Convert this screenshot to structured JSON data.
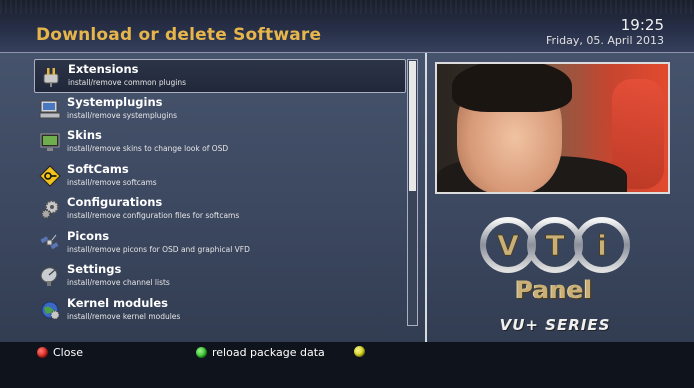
{
  "header": {
    "title": "Download or delete Software",
    "time": "19:25",
    "date": "Friday, 05. April 2013"
  },
  "menu": {
    "items": [
      {
        "title": "Extensions",
        "desc": "install/remove common plugins",
        "icon": "plug-icon",
        "selected": true
      },
      {
        "title": "Systemplugins",
        "desc": "install/remove systemplugins",
        "icon": "computer-icon",
        "selected": false
      },
      {
        "title": "Skins",
        "desc": "install/remove skins to change look of OSD",
        "icon": "monitor-icon",
        "selected": false
      },
      {
        "title": "SoftCams",
        "desc": "install/remove softcams",
        "icon": "key-warning-icon",
        "selected": false
      },
      {
        "title": "Configurations",
        "desc": "install/remove configuration files for softcams",
        "icon": "gears-icon",
        "selected": false
      },
      {
        "title": "Picons",
        "desc": "install/remove picons for OSD and graphical VFD",
        "icon": "satellite-icon",
        "selected": false
      },
      {
        "title": "Settings",
        "desc": "install/remove channel lists",
        "icon": "dish-icon",
        "selected": false
      },
      {
        "title": "Kernel modules",
        "desc": "install/remove kernel modules",
        "icon": "globe-gear-icon",
        "selected": false
      }
    ]
  },
  "logo": {
    "letters": [
      "V",
      "T",
      "i"
    ],
    "panel": "Panel",
    "series": "VU+ SERIES"
  },
  "footer": {
    "red_label": "Close",
    "green_label": "reload package data",
    "yellow_label": ""
  },
  "colors": {
    "accent": "#e7b64a",
    "red": "#d8261e",
    "green": "#34c52b",
    "yellow": "#d6d51a"
  }
}
